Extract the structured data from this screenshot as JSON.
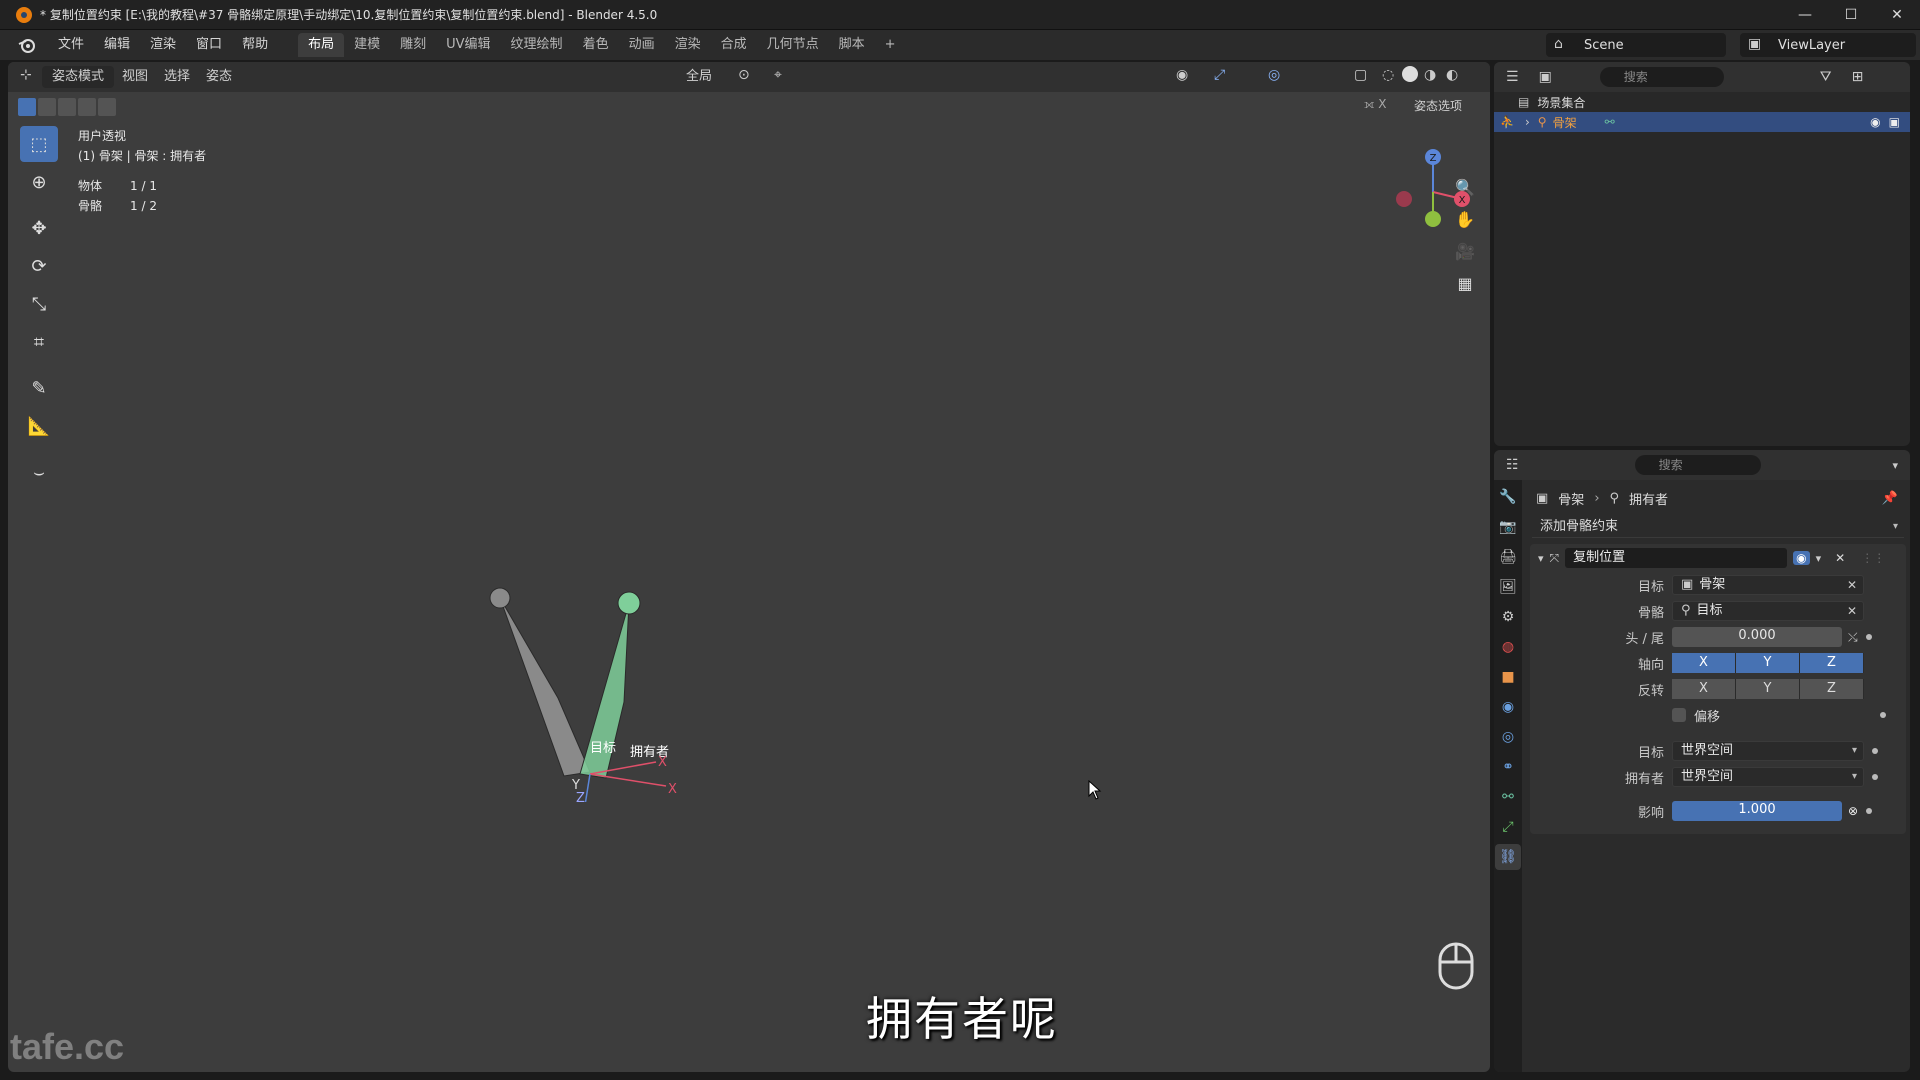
{
  "window": {
    "title": "* 复制位置约束 [E:\\我的教程\\#37 骨骼绑定原理\\手动绑定\\10.复制位置约束\\复制位置约束.blend] - Blender 4.5.0",
    "minimize": "—",
    "maximize": "☐",
    "close": "✕"
  },
  "menu": {
    "items": [
      "文件",
      "编辑",
      "渲染",
      "窗口",
      "帮助"
    ],
    "workspaces": [
      "布局",
      "建模",
      "雕刻",
      "UV编辑",
      "纹理绘制",
      "着色",
      "动画",
      "渲染",
      "合成",
      "几何节点",
      "脚本"
    ],
    "active_workspace": "布局",
    "add_tab": "+",
    "scene": "Scene",
    "view_layer": "ViewLayer"
  },
  "viewport": {
    "mode": "姿态模式",
    "menus": [
      "视图",
      "选择",
      "姿态"
    ],
    "transform_orientation": "全局",
    "pose_options": "姿态选项",
    "overlay_title": "用户透视",
    "overlay_subtitle": "(1) 骨架 | 骨架 : 拥有者",
    "stats": [
      {
        "label": "物体",
        "value": "1 / 1"
      },
      {
        "label": "骨骼",
        "value": "1 / 2"
      }
    ],
    "bone_labels": {
      "target": "目标",
      "owner": "拥有者"
    },
    "axis_labels": {
      "x": "X",
      "y": "Y",
      "z": "Z"
    },
    "gizmo": {
      "z": "Z",
      "x": "X"
    }
  },
  "subtitle": "拥有者呢",
  "watermark": "tafe.cc",
  "outliner": {
    "search_placeholder": "搜索",
    "rows": [
      {
        "label": "场景集合"
      },
      {
        "label": "骨架"
      }
    ]
  },
  "properties": {
    "search_placeholder": "搜索",
    "breadcrumb": [
      "骨架",
      "拥有者"
    ],
    "add_constraint": "添加骨骼约束",
    "constraint": {
      "name": "复制位置",
      "target_label": "目标",
      "target_value": "骨架",
      "bone_label": "骨骼",
      "bone_value": "目标",
      "head_tail_label": "头 / 尾",
      "head_tail_value": "0.000",
      "axis_label": "轴向",
      "axis_values": [
        "X",
        "Y",
        "Z"
      ],
      "invert_label": "反转",
      "invert_values": [
        "X",
        "Y",
        "Z"
      ],
      "offset_label": "偏移",
      "target_space_label": "目标",
      "target_space_value": "世界空间",
      "owner_space_label": "拥有者",
      "owner_space_value": "世界空间",
      "influence_label": "影响",
      "influence_value": "1.000"
    }
  },
  "colors": {
    "accent": "#4772b3",
    "viewport_bg": "#3d3d3d",
    "owner_bone": "#7fcf9a",
    "target_bone": "#8a8a8a",
    "axis_x": "#e0506a",
    "axis_y": "#8fbf3f",
    "axis_z": "#5b86d9"
  }
}
